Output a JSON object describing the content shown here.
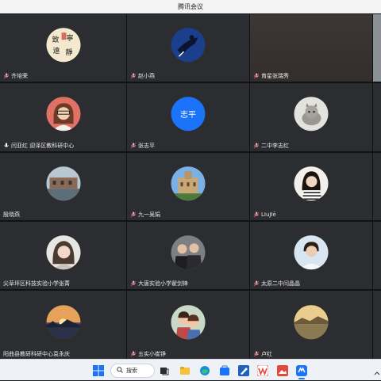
{
  "window": {
    "title": "腾讯会议"
  },
  "participants": [
    {
      "name": "齐培荣",
      "avatar": "calligraphy",
      "avatar_text": "致寧 遠靜"
    },
    {
      "name": "赵小燕",
      "avatar": "blue-figure"
    },
    {
      "name": "育星张瑞秀",
      "avatar": "video-dark"
    },
    {
      "name": "闫亚红 迎泽区教科研中心",
      "avatar": "cartoon-girl",
      "mic": "active"
    },
    {
      "name": "张志平",
      "avatar": "text-circle",
      "avatar_text": "志平"
    },
    {
      "name": "二中李志红",
      "avatar": "cat"
    },
    {
      "name": "殷晓燕",
      "avatar": "building-water"
    },
    {
      "name": "九一吴娟",
      "avatar": "castle"
    },
    {
      "name": "LIuJIē",
      "avatar": "girl-stripes"
    },
    {
      "name": "尖草坪区科技实验小学张菁",
      "avatar": "woman-portrait"
    },
    {
      "name": "大唐实验小学翟剑锋",
      "avatar": "group-photo"
    },
    {
      "name": "太原二中闫晶晶",
      "avatar": "man-portrait"
    },
    {
      "name": "阳曲县教研科研中心袁永庆",
      "avatar": "sunset"
    },
    {
      "name": "五实小崔铮",
      "avatar": "cartoon-couple"
    },
    {
      "name": "卢红",
      "avatar": "lake"
    }
  ],
  "taskbar": {
    "search_label": "搜索"
  },
  "colors": {
    "accent_blue": "#1a73f8",
    "tile_bg": "#2c2d31"
  }
}
